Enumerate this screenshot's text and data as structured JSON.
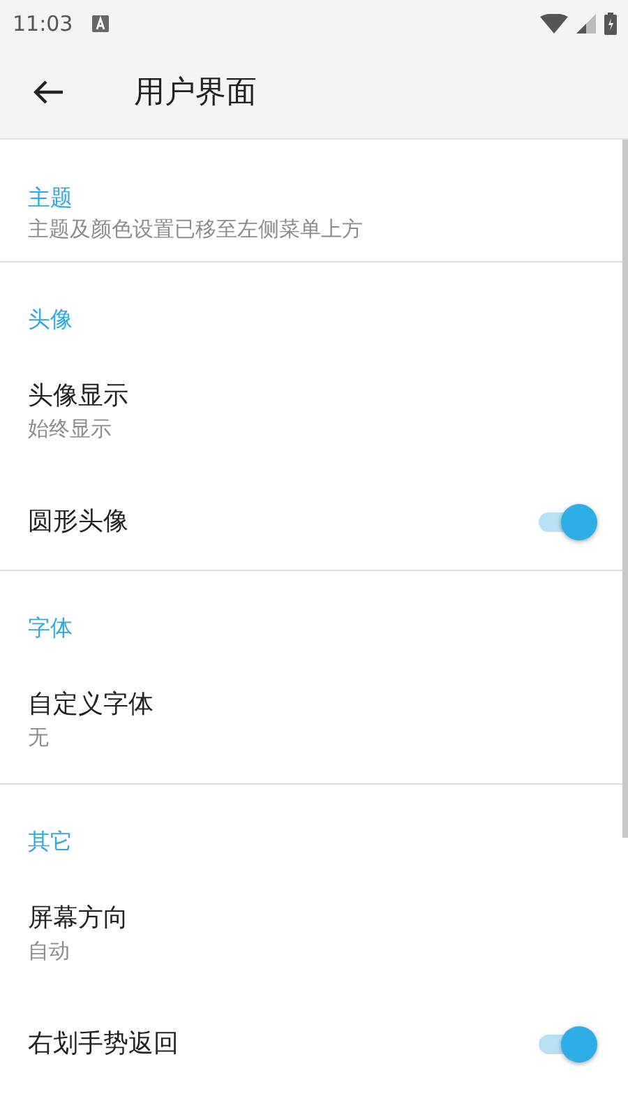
{
  "status_bar": {
    "time": "11:03"
  },
  "app_bar": {
    "title": "用户界面"
  },
  "sections": [
    {
      "title": "主题",
      "summary": "主题及颜色设置已移至左侧菜单上方"
    },
    {
      "title": "头像",
      "items": [
        {
          "kind": "text",
          "title": "头像显示",
          "summary": "始终显示"
        },
        {
          "kind": "switch",
          "title": "圆形头像",
          "on": true
        }
      ]
    },
    {
      "title": "字体",
      "items": [
        {
          "kind": "text",
          "title": "自定义字体",
          "summary": "无"
        }
      ]
    },
    {
      "title": "其它",
      "items": [
        {
          "kind": "text",
          "title": "屏幕方向",
          "summary": "自动"
        },
        {
          "kind": "switch",
          "title": "右划手势返回",
          "on": true
        }
      ]
    }
  ]
}
